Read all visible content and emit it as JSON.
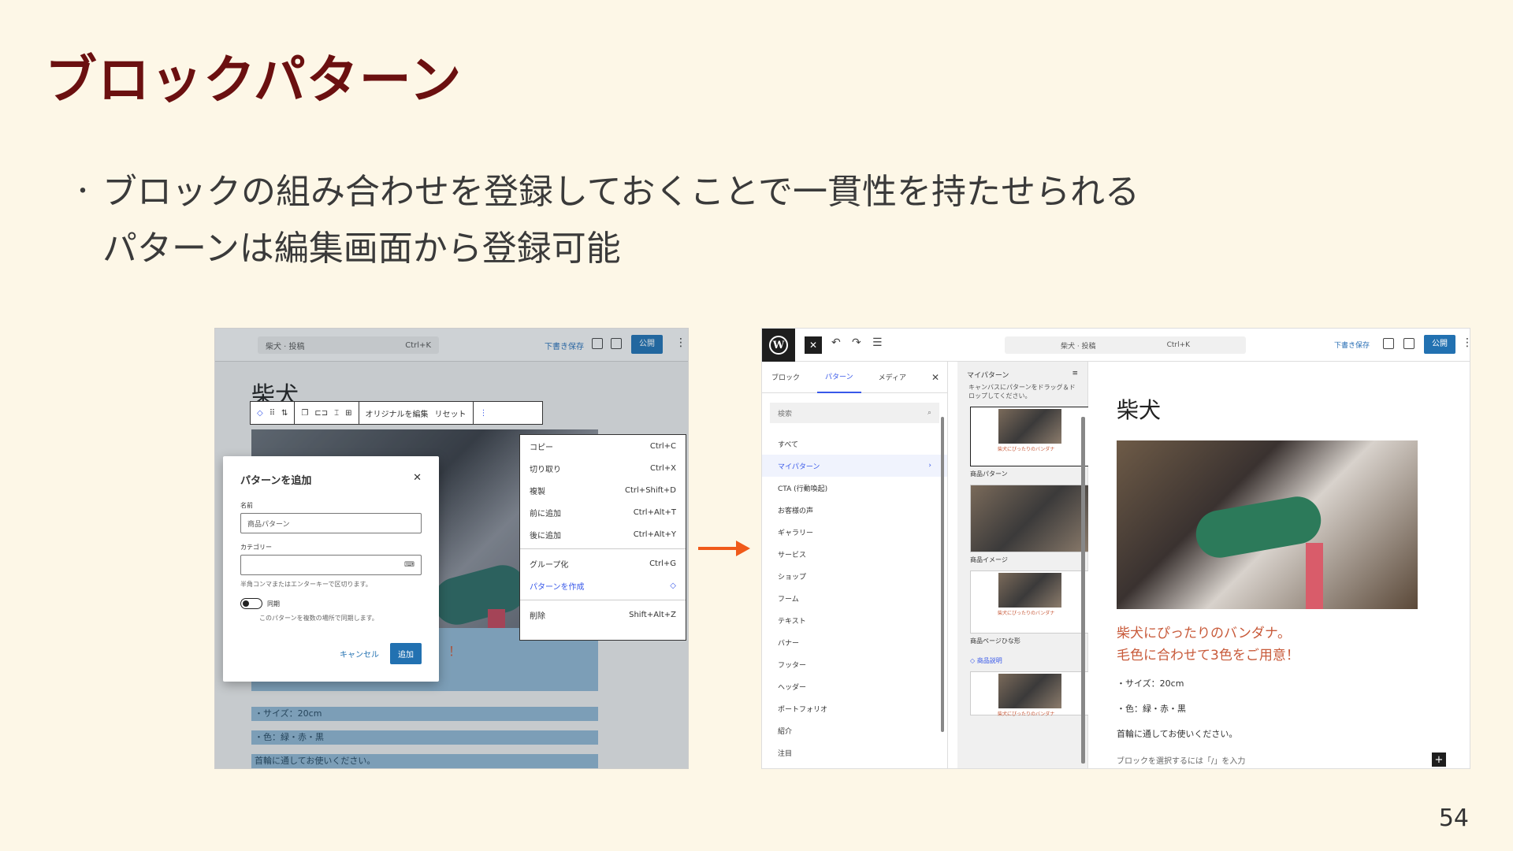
{
  "slide": {
    "title": "ブロックパターン",
    "bullets": [
      "ブロックの組み合わせを登録しておくことで一貫性を持たせられる",
      "パターンは編集画面から登録可能"
    ],
    "bullet_marker": "・",
    "page_number": "54"
  },
  "left_screenshot": {
    "topbar": {
      "search_text": "柴犬 · 投稿",
      "search_shortcut": "Ctrl+K",
      "save_draft": "下書き保存",
      "publish": "公開"
    },
    "doc_title": "柴犬",
    "block_toolbar": {
      "edit_original": "オリジナルを編集",
      "reset": "リセット"
    },
    "context_menu": [
      {
        "label": "コピー",
        "shortcut": "Ctrl+C"
      },
      {
        "label": "切り取り",
        "shortcut": "Ctrl+X"
      },
      {
        "label": "複製",
        "shortcut": "Ctrl+Shift+D"
      },
      {
        "label": "前に追加",
        "shortcut": "Ctrl+Alt+T"
      },
      {
        "label": "後に追加",
        "shortcut": "Ctrl+Alt+Y"
      },
      {
        "label": "グループ化",
        "shortcut": "Ctrl+G"
      },
      {
        "label": "パターンを作成",
        "shortcut": ""
      },
      {
        "label": "削除",
        "shortcut": "Shift+Alt+Z"
      }
    ],
    "modal": {
      "title": "パターンを追加",
      "name_label": "名前",
      "name_value": "商品パターン",
      "category_label": "カテゴリー",
      "category_value": "",
      "help_text": "半角コンマまたはエンターキーで区切ります。",
      "sync_label": "同期",
      "sync_help": "このパターンを複数の場所で同期します。",
      "cancel": "キャンセル",
      "add": "追加"
    },
    "list_lines": [
      "・サイズ：20cm",
      "・色：緑・赤・黒",
      "首輪に通してお使いください。"
    ],
    "exclaim": "！"
  },
  "right_screenshot": {
    "topbar": {
      "search_text": "柴犬 · 投稿",
      "search_shortcut": "Ctrl+K",
      "save_draft": "下書き保存",
      "publish": "公開"
    },
    "library_tabs": [
      "ブロック",
      "パターン",
      "メディア"
    ],
    "library_search_placeholder": "検索",
    "library_items": [
      "すべて",
      "マイパターン",
      "CTA (行動喚起)",
      "お客様の声",
      "ギャラリー",
      "サービス",
      "ショップ",
      "フーム",
      "テキスト",
      "バナー",
      "フッター",
      "ヘッダー",
      "ポートフォリオ",
      "紹介",
      "注目"
    ],
    "patterns_panel": {
      "title": "マイパターン",
      "hint": "キャンバスにパターンをドラッグ＆ドロップしてください。",
      "cards": [
        {
          "label": "商品パターン",
          "caption": "柴犬にぴったりのバンダナ"
        },
        {
          "label": "商品イメージ",
          "caption": ""
        },
        {
          "label": "商品ページひな形",
          "caption": "柴犬にぴったりのバンダナ"
        },
        {
          "label": "商品説明",
          "caption": "柴犬にぴったりのバンダナ"
        }
      ]
    },
    "editor": {
      "title": "柴犬",
      "red_lines": [
        "柴犬にぴったりのバンダナ。",
        "毛色に合わせて3色をご用意！"
      ],
      "list_lines": [
        "・サイズ：20cm",
        "・色：緑・赤・黒"
      ],
      "note": "首輪に通してお使いください。",
      "placeholder": "ブロックを選択するには「/」を入力"
    }
  },
  "colors": {
    "title": "#6b1010",
    "background": "#fdf7e7",
    "arrow": "#f05a1a",
    "wp_blue": "#2271b1",
    "accent": "#3858e9"
  }
}
